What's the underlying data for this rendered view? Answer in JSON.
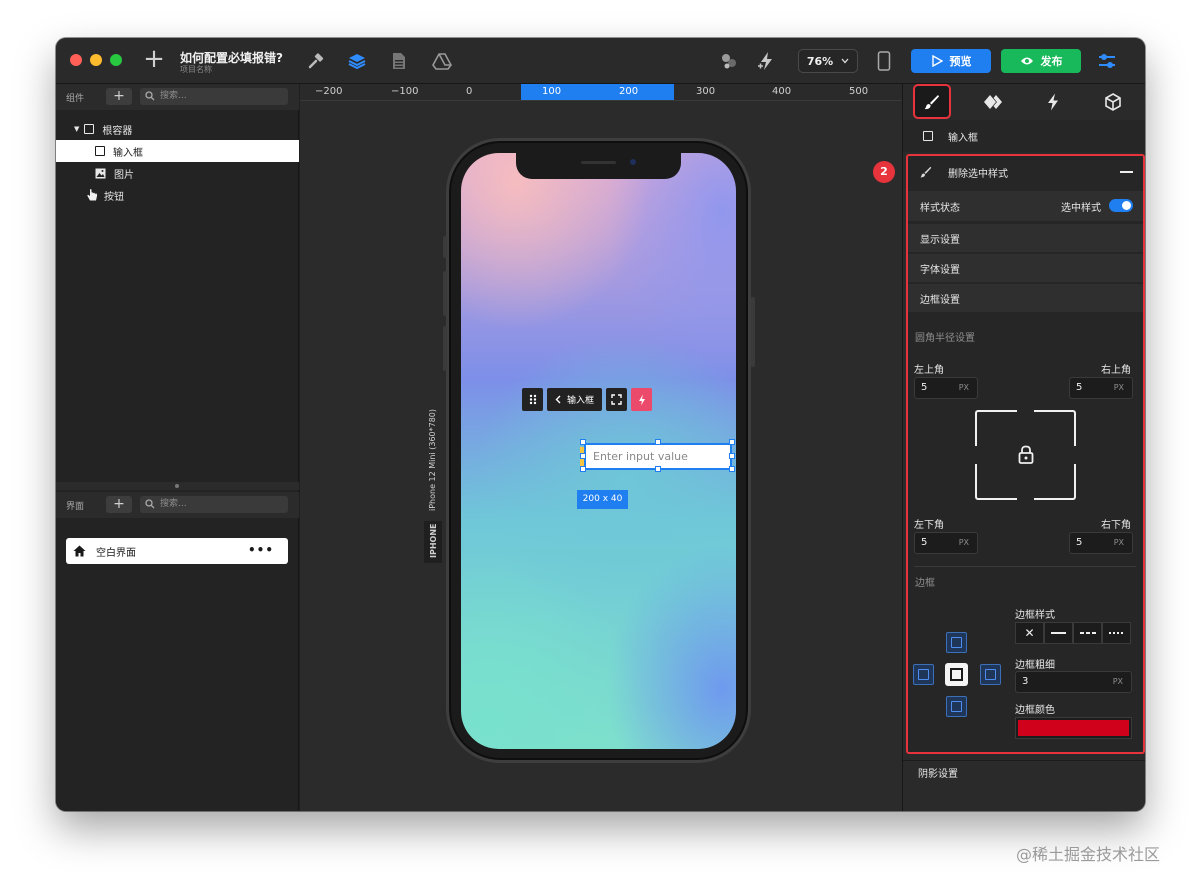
{
  "titlebar": {
    "project_title": "如何配置必填报错?",
    "project_sub": "项目名称",
    "zoom": "76%",
    "preview_label": "预览",
    "publish_label": "发布"
  },
  "components_panel": {
    "label": "组件",
    "add": "+",
    "search_placeholder": "搜索...",
    "tree": [
      {
        "label": "根容器"
      },
      {
        "label": "输入框"
      },
      {
        "label": "图片"
      },
      {
        "label": "按钮"
      }
    ]
  },
  "pages_panel": {
    "label": "界面",
    "add": "+",
    "search_placeholder": "搜索...",
    "page_name": "空白界面",
    "more": "•••"
  },
  "ruler": {
    "marks": [
      "−200",
      "−100",
      "0",
      "100",
      "200",
      "300",
      "400",
      "500"
    ]
  },
  "canvas": {
    "device_label": "iPhone 12 Mini (360*780)",
    "device_tag": "IPHONE",
    "float_toolbar_label": "输入框",
    "input_placeholder": "Enter input value",
    "size_tag": "200 x 40"
  },
  "inspector": {
    "selected_label": "输入框",
    "badge": "2",
    "delete_style": "删除选中样式",
    "style_state_label": "样式状态",
    "style_state_value": "选中样式",
    "display_settings": "显示设置",
    "font_settings": "字体设置",
    "border_settings": "边框设置",
    "radius_section": "圆角半径设置",
    "top_left_label": "左上角",
    "top_right_label": "右上角",
    "bottom_left_label": "左下角",
    "bottom_right_label": "右下角",
    "top_left": "5",
    "top_right": "5",
    "bottom_left": "5",
    "bottom_right": "5",
    "unit": "PX",
    "border_section": "边框",
    "border_style_label": "边框样式",
    "border_width_label": "边框粗细",
    "border_width": "3",
    "border_color_label": "边框颜色",
    "border_color": "#d0021b",
    "shadow_settings": "阴影设置"
  },
  "watermark": "@稀土掘金技术社区",
  "colors": {
    "accent": "#1f7ef0",
    "publish": "#18b95a",
    "highlight": "#e6333c"
  }
}
